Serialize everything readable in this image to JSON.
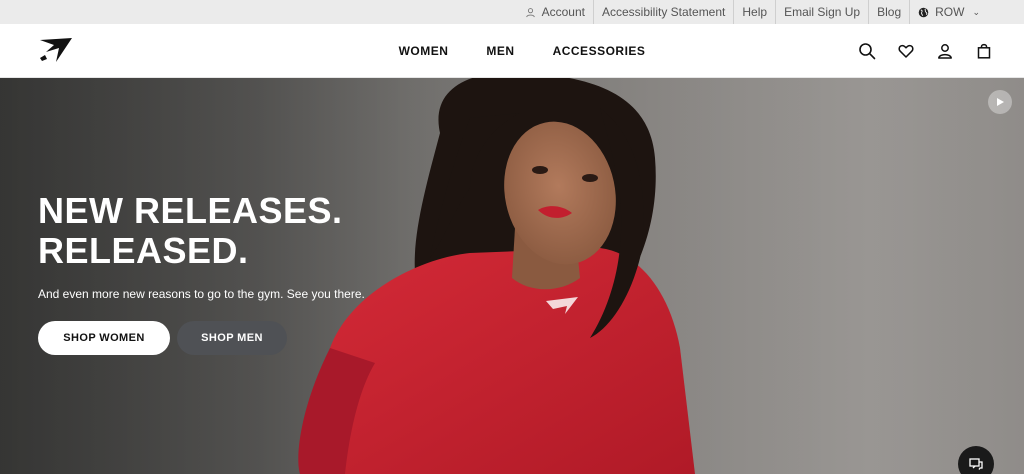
{
  "utility_bar": {
    "links": [
      {
        "label": "Account",
        "icon": "user-icon"
      },
      {
        "label": "Accessibility Statement"
      },
      {
        "label": "Help"
      },
      {
        "label": "Email Sign Up"
      },
      {
        "label": "Blog"
      },
      {
        "label": "ROW",
        "icon": "globe-icon"
      }
    ]
  },
  "header": {
    "logo": "gymshark-logo",
    "nav": [
      {
        "label": "WOMEN"
      },
      {
        "label": "MEN"
      },
      {
        "label": "ACCESSORIES"
      }
    ],
    "icons": [
      "search-icon",
      "heart-icon",
      "account-icon",
      "bag-icon"
    ]
  },
  "hero": {
    "title_line1": "NEW RELEASES.",
    "title_line2": "RELEASED.",
    "subtitle": "And even more new reasons to go to the gym. See you there.",
    "shop_women_label": "SHOP WOMEN",
    "shop_men_label": "SHOP MEN",
    "top_color": "#c81e2c"
  },
  "colors": {
    "utility_bg": "#ebebeb",
    "header_bg": "#ffffff",
    "accent_dark": "#111111",
    "secondary_button": "#4f5155"
  }
}
